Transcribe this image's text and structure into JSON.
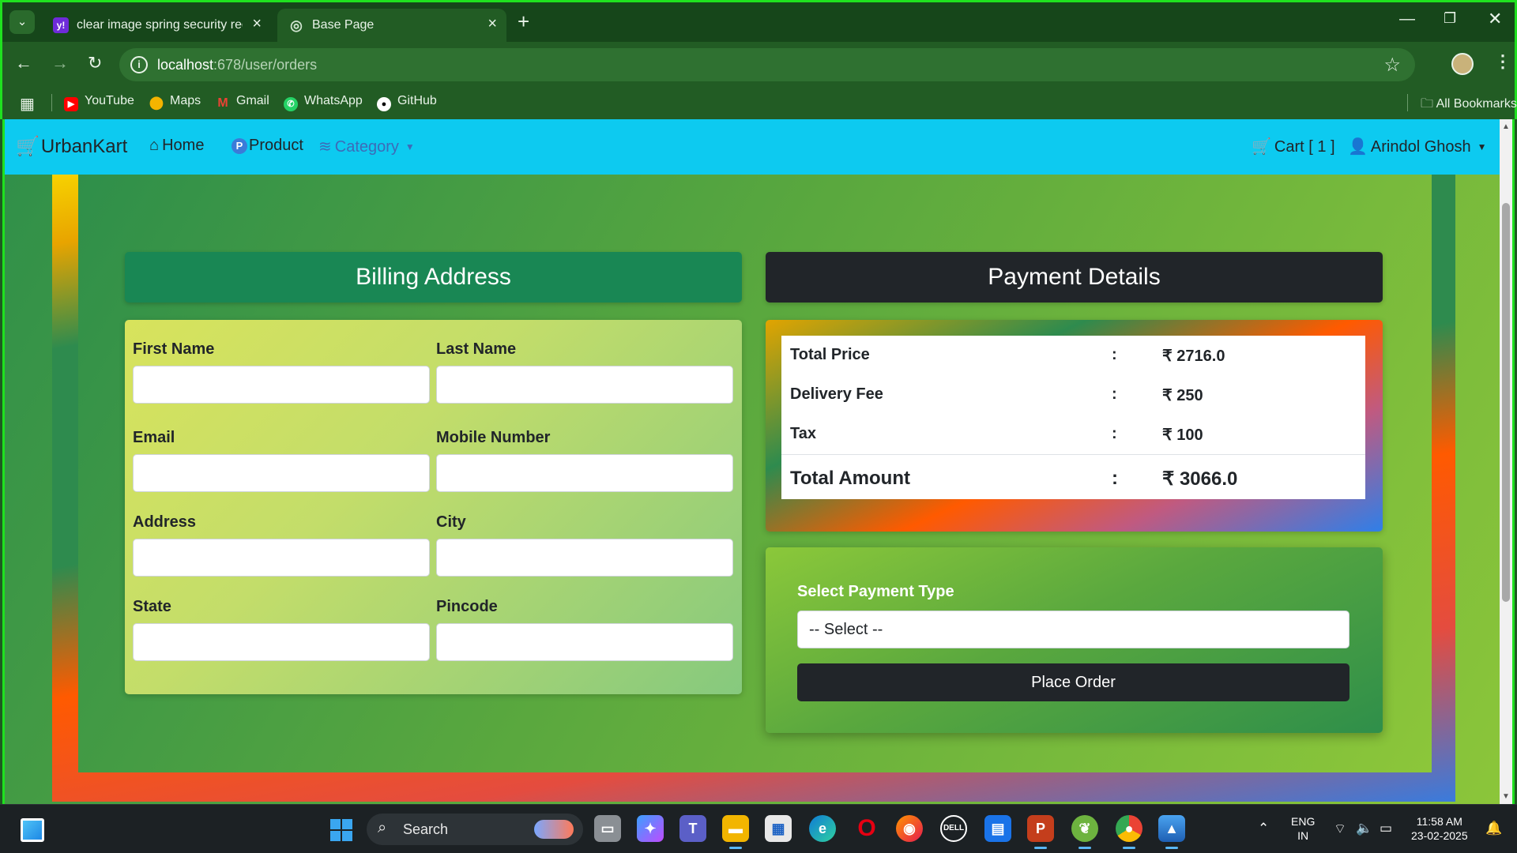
{
  "browser": {
    "tabs": [
      {
        "title": "clear image spring security regi",
        "favicon": "yahoo-icon"
      },
      {
        "title": "Base Page",
        "favicon": "globe-icon"
      }
    ],
    "url_host": "localhost",
    "url_path": ":678/user/orders",
    "bookmarks": [
      "YouTube",
      "Maps",
      "Gmail",
      "WhatsApp",
      "GitHub"
    ],
    "all_bookmarks": "All Bookmarks"
  },
  "site_nav": {
    "brand": "UrbanKart",
    "home": "Home",
    "product": "Product",
    "category": "Category",
    "cart": "Cart [ 1 ]",
    "user": "Arindol Ghosh"
  },
  "billing": {
    "header": "Billing Address",
    "fields": {
      "first_name": "First Name",
      "last_name": "Last Name",
      "email": "Email",
      "mobile": "Mobile Number",
      "address": "Address",
      "city": "City",
      "state": "State",
      "pincode": "Pincode"
    }
  },
  "payment": {
    "header": "Payment Details",
    "rows": [
      {
        "label": "Total Price",
        "sep": ":",
        "value": "₹ 2716.0"
      },
      {
        "label": "Delivery Fee",
        "sep": ":",
        "value": "₹ 250"
      },
      {
        "label": "Tax",
        "sep": ":",
        "value": "₹ 100"
      }
    ],
    "total": {
      "label": "Total Amount",
      "sep": ":",
      "value": "₹ 3066.0"
    },
    "payment_type_label": "Select Payment Type",
    "payment_type_selected": "-- Select --",
    "place_order": "Place Order"
  },
  "taskbar": {
    "search": "Search",
    "lang": "ENG",
    "region": "IN",
    "time": "11:58 AM",
    "date": "23-02-2025"
  },
  "colors": {
    "navbar": "#0dcaf0",
    "billing_header": "#198754",
    "payment_header": "#212529",
    "window_border": "#1fe11f"
  }
}
